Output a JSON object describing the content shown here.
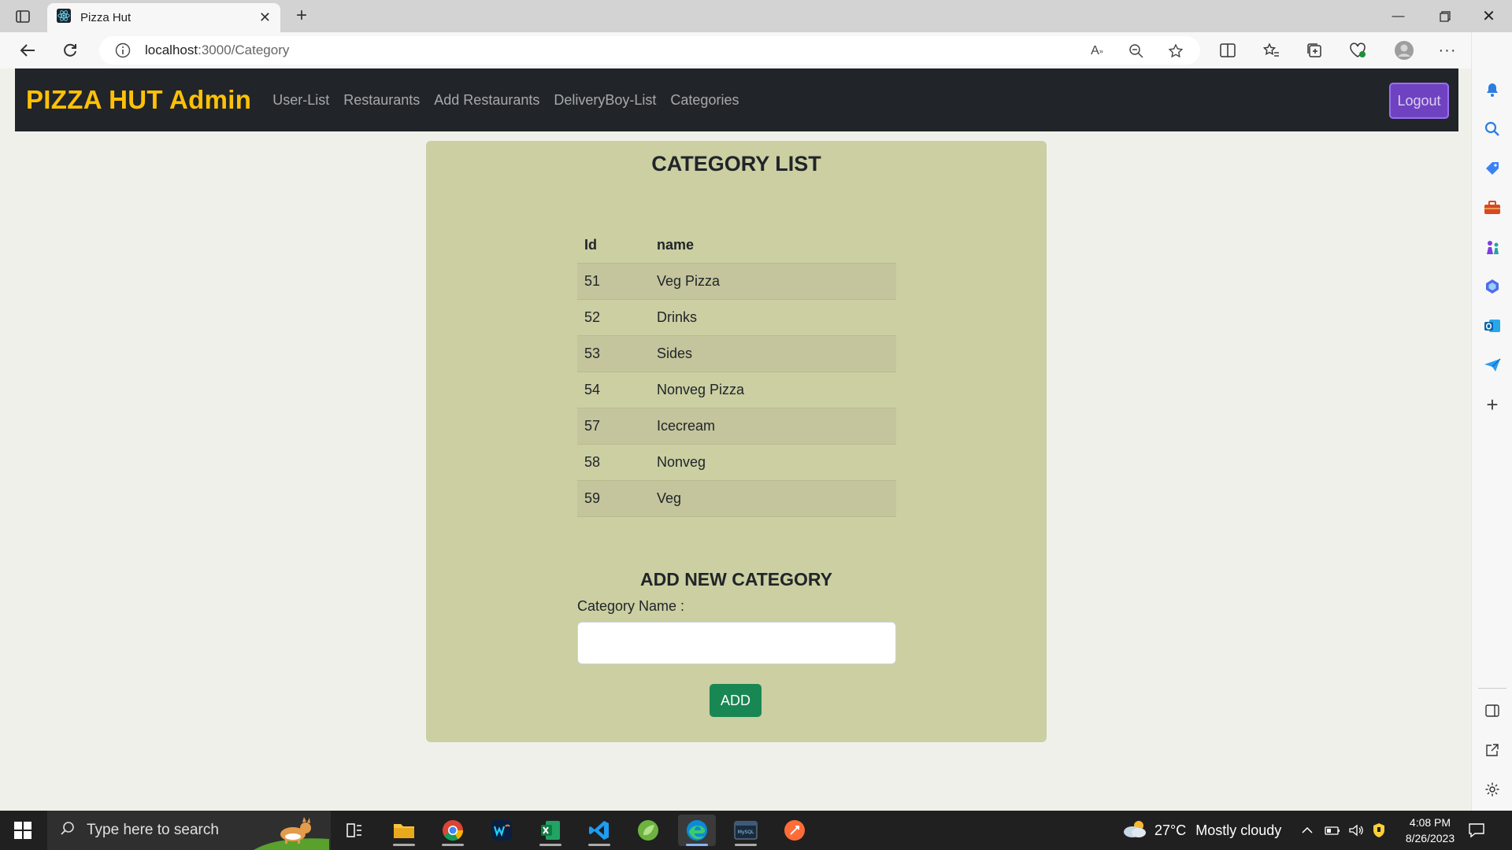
{
  "browser": {
    "tab_title": "Pizza Hut",
    "url_host": "localhost",
    "url_path": ":3000/Category"
  },
  "navbar": {
    "brand": "PIZZA HUT Admin",
    "links": [
      "User-List",
      "Restaurants",
      "Add Restaurants",
      "DeliveryBoy-List",
      "Categories"
    ],
    "logout": "Logout"
  },
  "category_list": {
    "title": "CATEGORY LIST",
    "headers": {
      "id": "Id",
      "name": "name"
    },
    "rows": [
      {
        "id": "51",
        "name": "Veg Pizza"
      },
      {
        "id": "52",
        "name": "Drinks"
      },
      {
        "id": "53",
        "name": "Sides"
      },
      {
        "id": "54",
        "name": "Nonveg Pizza"
      },
      {
        "id": "57",
        "name": "Icecream"
      },
      {
        "id": "58",
        "name": "Nonveg"
      },
      {
        "id": "59",
        "name": "Veg"
      }
    ]
  },
  "add_category": {
    "title": "ADD NEW CATEGORY",
    "label": "Category Name :",
    "input_value": "",
    "button": "ADD"
  },
  "taskbar": {
    "search_placeholder": "Type here to search",
    "weather_temp": "27°C",
    "weather_desc": "Mostly cloudy",
    "time": "4:08 PM",
    "date": "8/26/2023"
  },
  "colors": {
    "brand": "#ffc107",
    "navbar_bg": "#212529",
    "card_bg": "#cbcfa2",
    "logout_bg": "#6f42c1",
    "add_btn_bg": "#198754"
  }
}
